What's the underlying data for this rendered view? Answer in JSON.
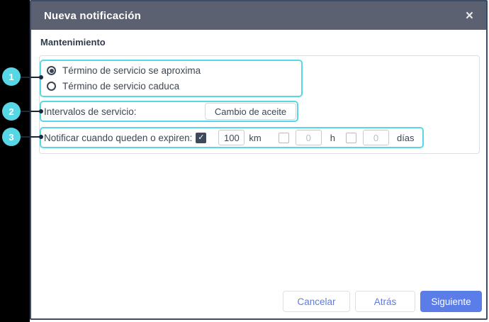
{
  "dialog": {
    "title": "Nueva notificación",
    "section_title": "Mantenimiento"
  },
  "icons": {
    "close": "×",
    "check": "✓"
  },
  "callouts": [
    "1",
    "2",
    "3"
  ],
  "radio_group": {
    "options": [
      {
        "label": "Término de servicio se aproxima",
        "selected": true
      },
      {
        "label": "Término de servicio caduca",
        "selected": false
      }
    ]
  },
  "service_interval": {
    "label": "Intervalos de servicio:",
    "value": "Cambio de aceite"
  },
  "notify": {
    "label": "Notificar cuando queden o expiren:",
    "fields": [
      {
        "checked": true,
        "value": "100",
        "unit": "km",
        "enabled": true
      },
      {
        "checked": false,
        "value": "0",
        "unit": "h",
        "enabled": false
      },
      {
        "checked": false,
        "value": "0",
        "unit": "días",
        "enabled": false
      }
    ]
  },
  "footer": {
    "cancel_label": "Cancelar",
    "back_label": "Atrás",
    "next_label": "Siguiente"
  },
  "colors": {
    "header": "#5b6170",
    "highlight_cyan": "#58d8e7",
    "primary_blue": "#5b7de8",
    "dialog_border": "#3e4c63"
  }
}
